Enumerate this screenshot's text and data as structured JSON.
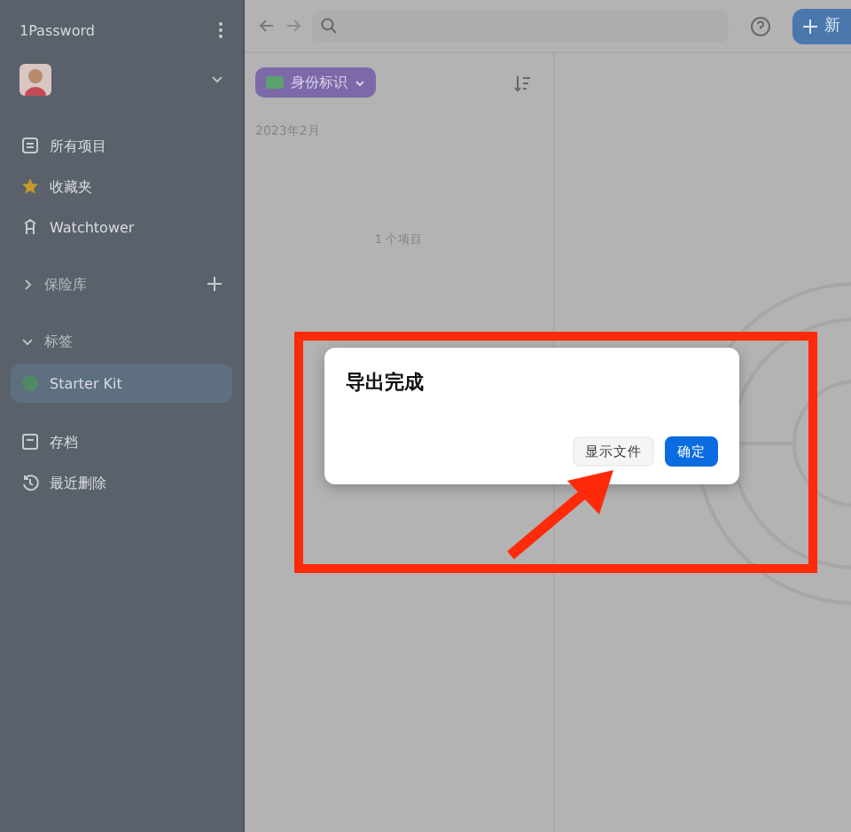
{
  "sidebar": {
    "app_name": "1Password",
    "account": {
      "expanded": false
    },
    "items": [
      {
        "kind": "item",
        "label": "所有项目",
        "selected": false
      },
      {
        "kind": "item",
        "label": "收藏夹",
        "selected": false
      },
      {
        "kind": "item",
        "label": "Watchtower",
        "selected": false
      },
      {
        "kind": "section",
        "label": "保险库",
        "expanded": false,
        "addable": true
      },
      {
        "kind": "section",
        "label": "标签",
        "expanded": true,
        "addable": false,
        "children": [
          {
            "kind": "tag",
            "label": "Starter Kit",
            "selected": true
          }
        ]
      },
      {
        "kind": "item",
        "label": "存档",
        "selected": false
      },
      {
        "kind": "item",
        "label": "最近删除",
        "selected": false
      }
    ]
  },
  "toolbar": {
    "new_button": "新"
  },
  "list": {
    "filter": "身份标识",
    "group": "2023年2月",
    "count": "1 个项目"
  },
  "dialog": {
    "title": "导出完成",
    "buttons": [
      {
        "label": "显示文件",
        "primary": false
      },
      {
        "label": "确定",
        "primary": true
      }
    ]
  }
}
